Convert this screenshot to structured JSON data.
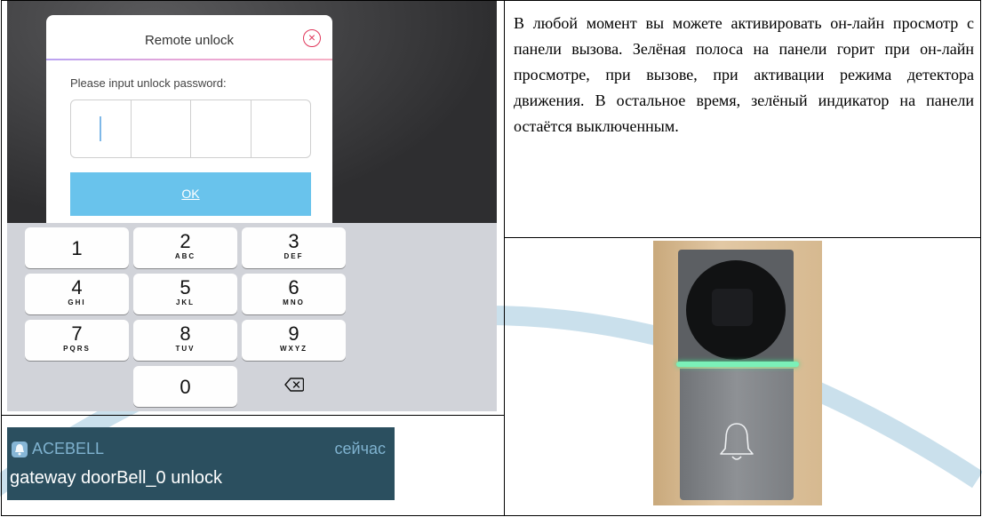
{
  "dialog": {
    "title": "Remote unlock",
    "close_glyph": "×",
    "label": "Please input unlock password:",
    "ok_label": "OK"
  },
  "keypad": {
    "keys": [
      {
        "num": "1",
        "letters": ""
      },
      {
        "num": "2",
        "letters": "ABC"
      },
      {
        "num": "3",
        "letters": "DEF"
      },
      {
        "num": "4",
        "letters": "GHI"
      },
      {
        "num": "5",
        "letters": "JKL"
      },
      {
        "num": "6",
        "letters": "MNO"
      },
      {
        "num": "7",
        "letters": "PQRS"
      },
      {
        "num": "8",
        "letters": "TUV"
      },
      {
        "num": "9",
        "letters": "WXYZ"
      },
      {
        "num": "0",
        "letters": ""
      }
    ]
  },
  "notification": {
    "app": "ACEBELL",
    "time": "сейчас",
    "message": "gateway doorBell_0 unlock"
  },
  "description": "В любой момент вы можете активировать он-лайн просмотр с панели вызова. Зелёная полоса на панели горит при он-лайн просмотре, при вызове, при активации режима детектора движения. В остальное время, зелёный индикатор на панели остаётся выключенным.",
  "colors": {
    "ok_button": "#69c3ec",
    "close_icon": "#e0365a",
    "notification_bg": "#2b4f5f",
    "indicator_glow": "#7bf0b8"
  },
  "icons": {
    "close": "close-circle-icon",
    "backspace": "backspace-icon",
    "app": "acebell-app-icon",
    "bell": "bell-icon"
  }
}
